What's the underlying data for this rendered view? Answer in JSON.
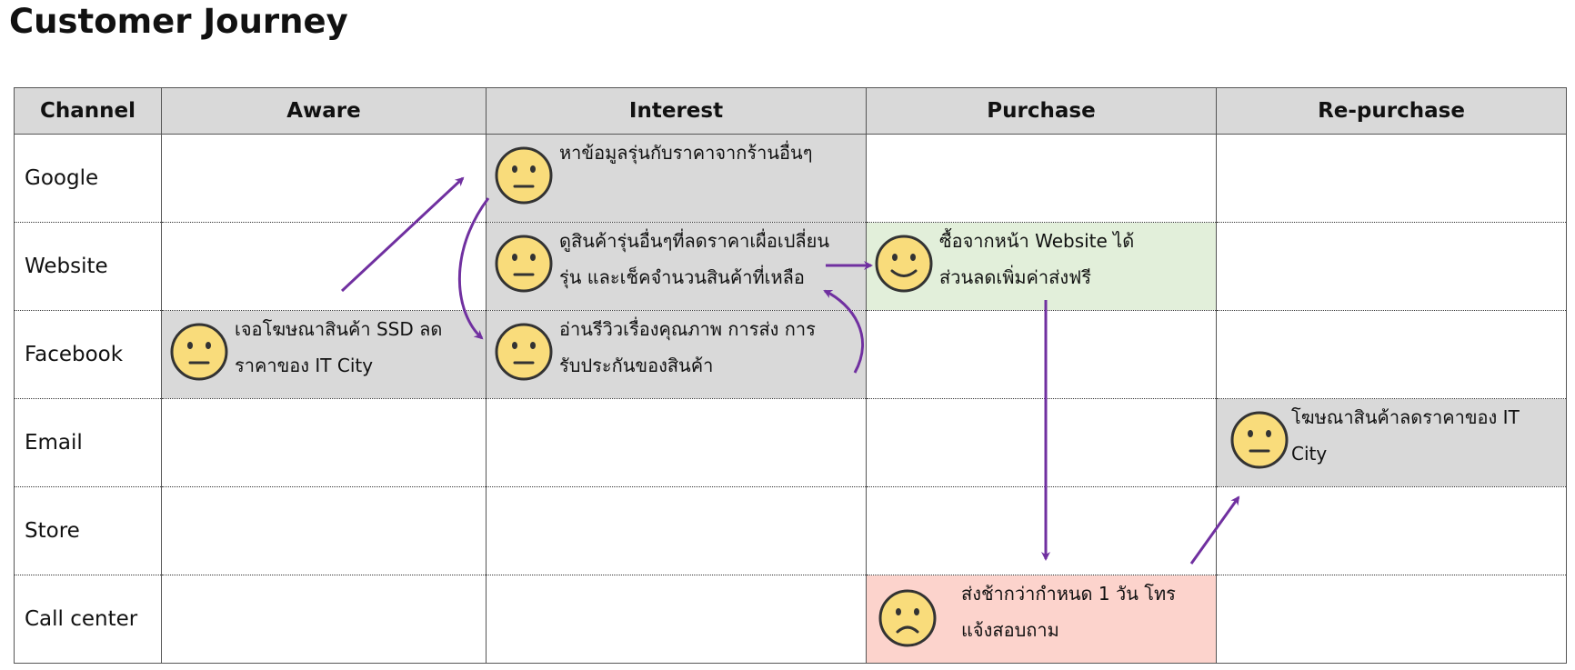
{
  "title": "Customer Journey",
  "colors": {
    "neutral_bg": "#d9d9d9",
    "positive_bg": "#e2efda",
    "negative_bg": "#fcd3cc",
    "header_bg": "#d9d9d9",
    "arrow": "#7030a0",
    "face_fill": "#f9dc7b",
    "face_stroke": "#333333"
  },
  "columns": [
    "Channel",
    "Aware",
    "Interest",
    "Purchase",
    "Re-purchase"
  ],
  "rows": [
    "Google",
    "Website",
    "Facebook",
    "Email",
    "Store",
    "Call center"
  ],
  "touchpoints": [
    {
      "row": "Facebook",
      "stage": "Aware",
      "mood": "neutral",
      "bg": "#d9d9d9",
      "lines": [
        "เจอโฆษณาสินค้า SSD ลด",
        "ราคาของ IT City"
      ]
    },
    {
      "row": "Google",
      "stage": "Interest",
      "mood": "neutral",
      "bg": "#d9d9d9",
      "lines": [
        "หาข้อมูลรุ่นกับราคาจากร้านอื่นๆ"
      ]
    },
    {
      "row": "Website",
      "stage": "Interest",
      "mood": "neutral",
      "bg": "#d9d9d9",
      "lines": [
        "ดูสินค้ารุ่นอื่นๆที่ลดราคาเผื่อเปลี่ยน",
        "รุ่น และเช็คจำนวนสินค้าที่เหลือ"
      ]
    },
    {
      "row": "Facebook",
      "stage": "Interest",
      "mood": "neutral",
      "bg": "#d9d9d9",
      "lines": [
        "อ่านรีวิวเรื่องคุณภาพ การส่ง การ",
        "รับประกันของสินค้า"
      ]
    },
    {
      "row": "Website",
      "stage": "Purchase",
      "mood": "happy",
      "bg": "#e2efda",
      "lines": [
        "ซื้อจากหน้า Website ได้",
        "ส่วนลดเพิ่มค่าส่งฟรี"
      ]
    },
    {
      "row": "Call center",
      "stage": "Purchase",
      "mood": "sad",
      "bg": "#fcd3cc",
      "lines": [
        "ส่งช้ากว่ากำหนด 1 วัน โทร",
        "แจ้งสอบถาม"
      ]
    },
    {
      "row": "Email",
      "stage": "Re-purchase",
      "mood": "neutral",
      "bg": "#d9d9d9",
      "lines": [
        "โฆษณาสินค้าลดราคาของ IT",
        "City"
      ]
    }
  ]
}
